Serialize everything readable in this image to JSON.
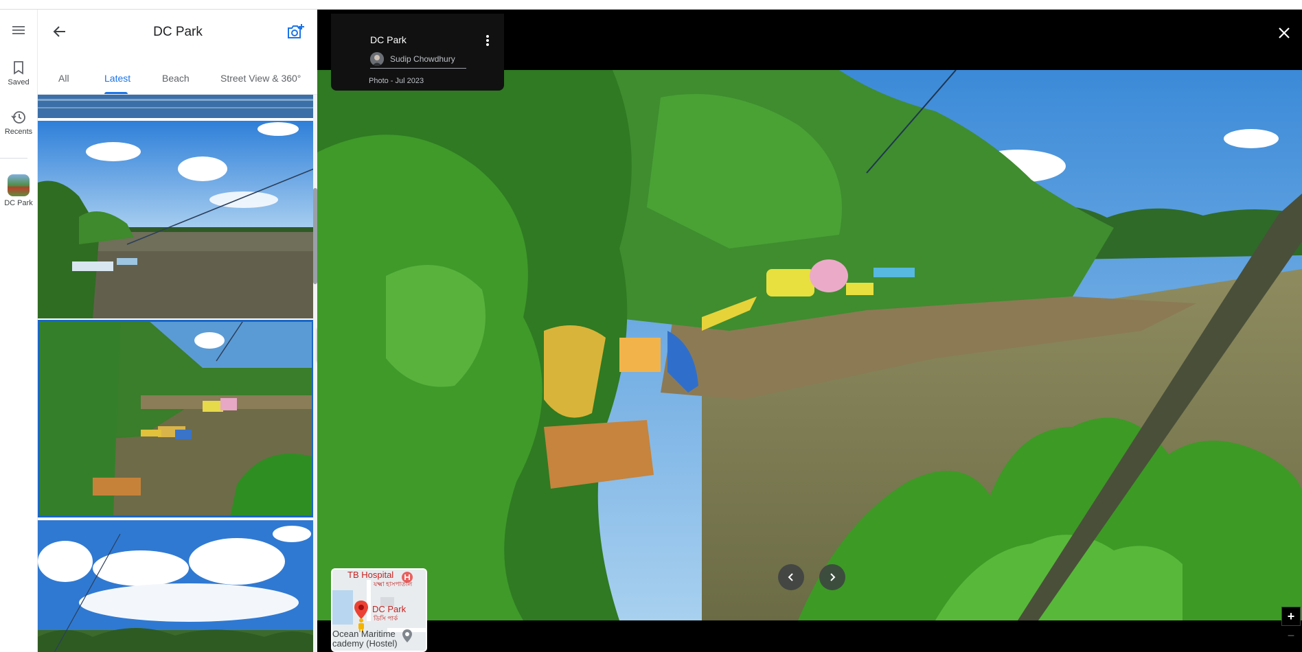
{
  "rail": {
    "menu_icon": "hamburger-icon",
    "saved_label": "Saved",
    "recents_label": "Recents",
    "place_label": "DC Park"
  },
  "panel": {
    "title": "DC Park",
    "back_icon": "arrow-back-icon",
    "add_photo_icon": "add-photo-icon",
    "tabs": [
      {
        "label": "All",
        "active": false
      },
      {
        "label": "Latest",
        "active": true
      },
      {
        "label": "Beach",
        "active": false
      },
      {
        "label": "Street View & 360°",
        "active": false
      }
    ],
    "selected_photo_index": 2
  },
  "viewer": {
    "place_title": "DC Park",
    "author": "Sudip Chowdhury",
    "photo_date": "Photo - Jul 2023",
    "more_icon": "more-vert-icon",
    "close_icon": "close-icon",
    "prev_icon": "chevron-left-icon",
    "next_icon": "chevron-right-icon",
    "zoom_in_label": "+",
    "zoom_out_label": "−",
    "minimap": {
      "labels": {
        "hospital": "TB Hospital",
        "hospital_bn": "যক্ষ্মা হাসপাতাল",
        "park": "DC Park",
        "park_bn": "ডিসি পার্ক",
        "academy_line1": "Ocean Maritime",
        "academy_line2": "cademy (Hostel)"
      }
    }
  },
  "colors": {
    "accent": "#1a73e8",
    "viewer_bg": "#000000",
    "selected_border": "#1a66c9"
  }
}
